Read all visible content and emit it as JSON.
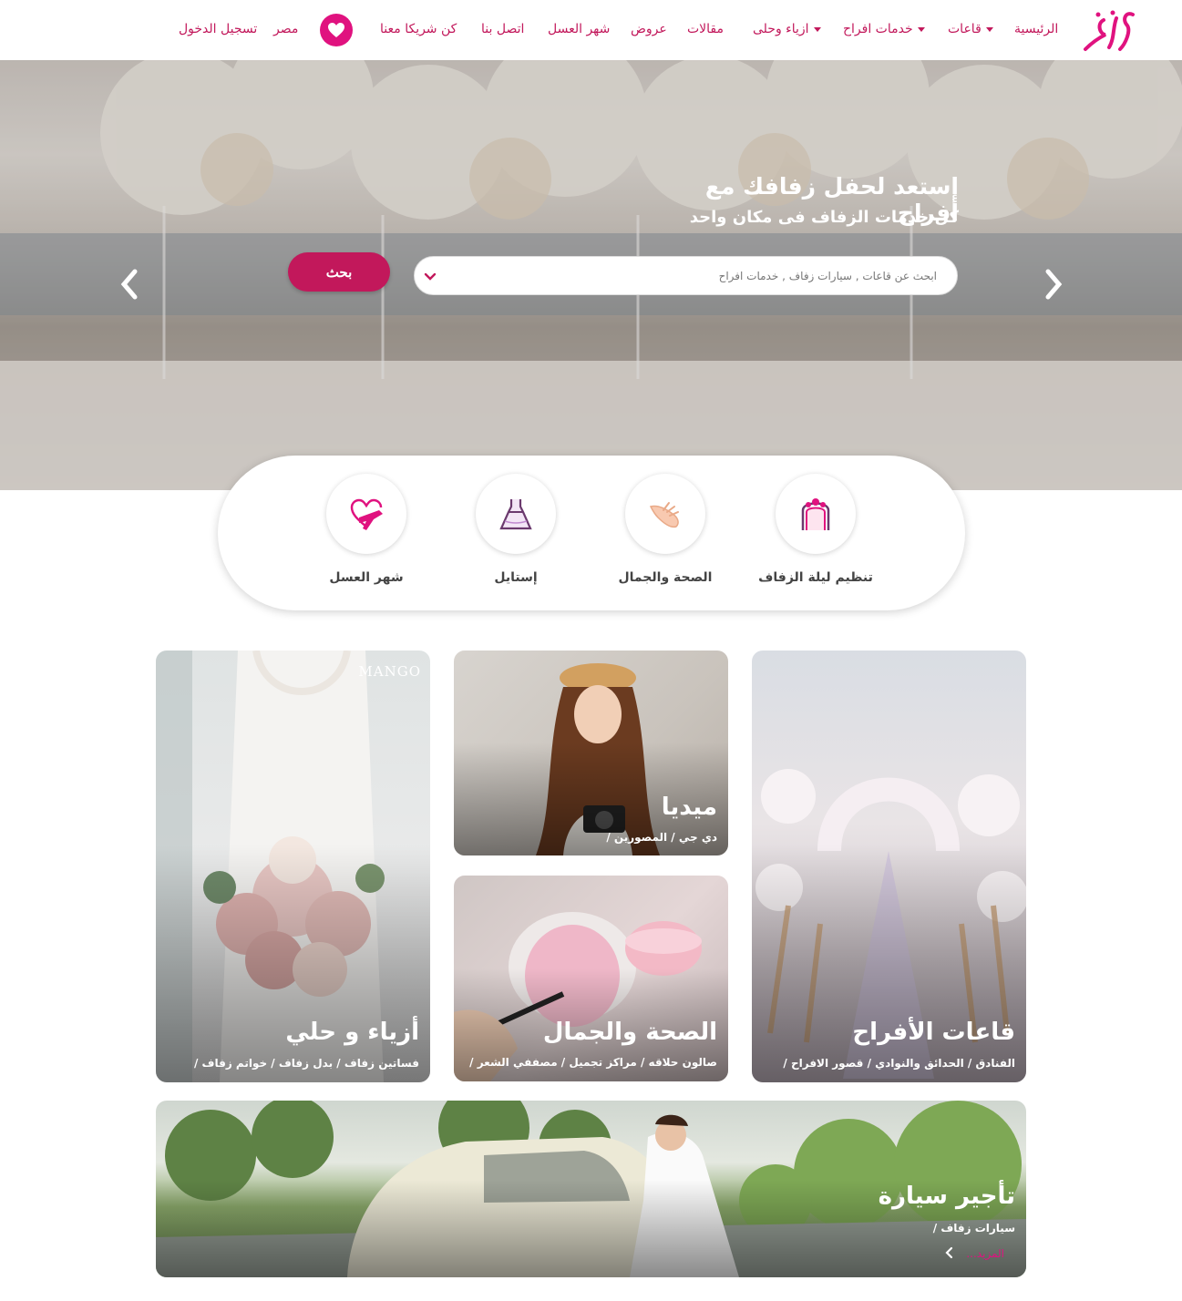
{
  "nav": {
    "logo_text": "أفراح",
    "items": [
      {
        "label": "الرئيسية",
        "has_caret": false
      },
      {
        "label": "قاعات",
        "has_caret": true
      },
      {
        "label": "خدمات افراح",
        "has_caret": true
      },
      {
        "label": "ازياء وحلى",
        "has_caret": true
      },
      {
        "label": "مقالات",
        "has_caret": false
      },
      {
        "label": "عروض",
        "has_caret": false
      },
      {
        "label": "شهر العسل",
        "has_caret": false
      },
      {
        "label": "اتصل بنا",
        "has_caret": false
      },
      {
        "label": "كن شريكا معنا",
        "has_caret": false
      }
    ],
    "country": "مصر",
    "login": "تسجيل الدخول",
    "accent": "#e0127f"
  },
  "hero": {
    "title": "إستعد لحفل زفافك مع أفراح",
    "subtitle": "كل خدمات الزفاف فى مكان واحد",
    "search_placeholder": "ابحث عن قاعات , سيارات زفاف , خدمات افراح",
    "search_button": "بحث"
  },
  "categories": [
    {
      "label": "تنظيم ليلة الزفاف",
      "icon": "wedding-arch-icon"
    },
    {
      "label": "الصحة والجمال",
      "icon": "hand-care-icon"
    },
    {
      "label": "إستايل",
      "icon": "dress-icon"
    },
    {
      "label": "شهر العسل",
      "icon": "plane-heart-icon"
    }
  ],
  "cards": {
    "halls": {
      "title": "قاعات الأفراح",
      "links": "الفنادق / الحدائق والنوادي / قصور الافراح /"
    },
    "media": {
      "title": "ميديا",
      "links": "دي جي / المصورين /"
    },
    "beauty": {
      "title": "الصحة والجمال",
      "links": "صالون حلاقه / مراكز تجميل / مصففي الشعر /"
    },
    "fashion": {
      "title": "أزياء و حلي",
      "links": "فساتين زفاف / بدل زفاف / خواتم زفاف /",
      "watermark": "MANGO"
    },
    "cars": {
      "title": "تأجير سيارة",
      "links": "سيارات زفاف /",
      "more": "المزيد..."
    }
  }
}
